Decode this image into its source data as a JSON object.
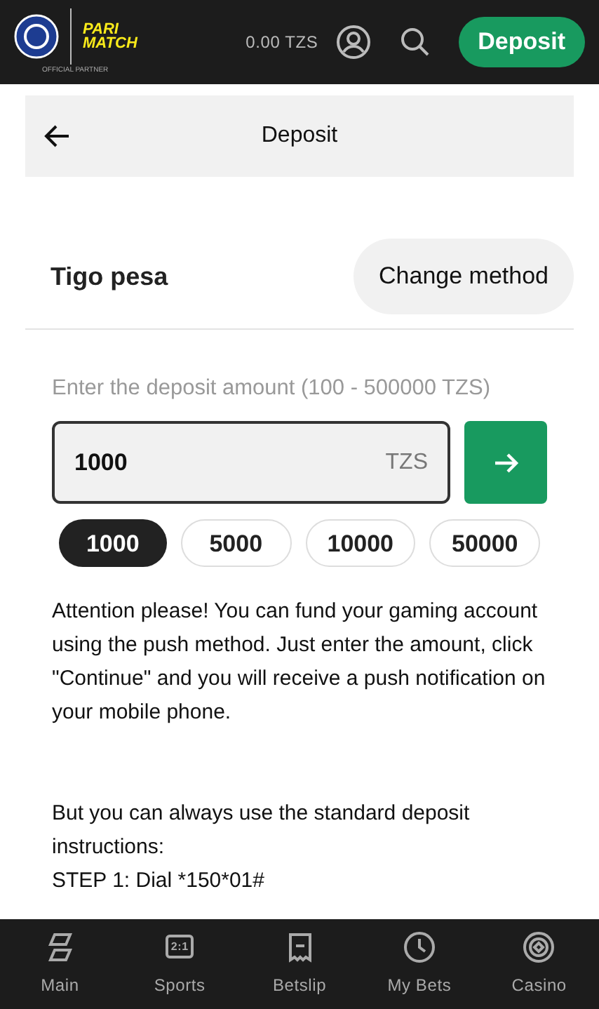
{
  "header": {
    "logo_brand": [
      "PARI",
      "MATCH"
    ],
    "logo_caption": "OFFICIAL PARTNER",
    "balance": "0.00 TZS",
    "deposit_button": "Deposit"
  },
  "title_bar": {
    "title": "Deposit"
  },
  "method": {
    "name": "Tigo pesa",
    "change_button": "Change method"
  },
  "amount": {
    "label": "Enter the deposit amount (100 - 500000 TZS)",
    "value": "1000",
    "currency": "TZS"
  },
  "presets": [
    {
      "label": "1000",
      "selected": true
    },
    {
      "label": "5000",
      "selected": false
    },
    {
      "label": "10000",
      "selected": false
    },
    {
      "label": "50000",
      "selected": false
    }
  ],
  "info": [
    "Attention please! You can fund your gaming account using the push method. Just enter the amount, click \"Continue\" and you will receive a push notification on your mobile phone.",
    "But you can always use the standard deposit instructions:",
    "STEP 1: Dial *150*01#"
  ],
  "nav": [
    {
      "kind": "main",
      "label": "Main",
      "selected": false
    },
    {
      "kind": "sports",
      "label": "Sports",
      "icon_text": "2:1",
      "selected": false
    },
    {
      "kind": "betslip",
      "label": "Betslip",
      "selected": false
    },
    {
      "kind": "bets",
      "label": "My Bets",
      "selected": false
    },
    {
      "kind": "casino",
      "label": "Casino",
      "selected": false
    }
  ]
}
